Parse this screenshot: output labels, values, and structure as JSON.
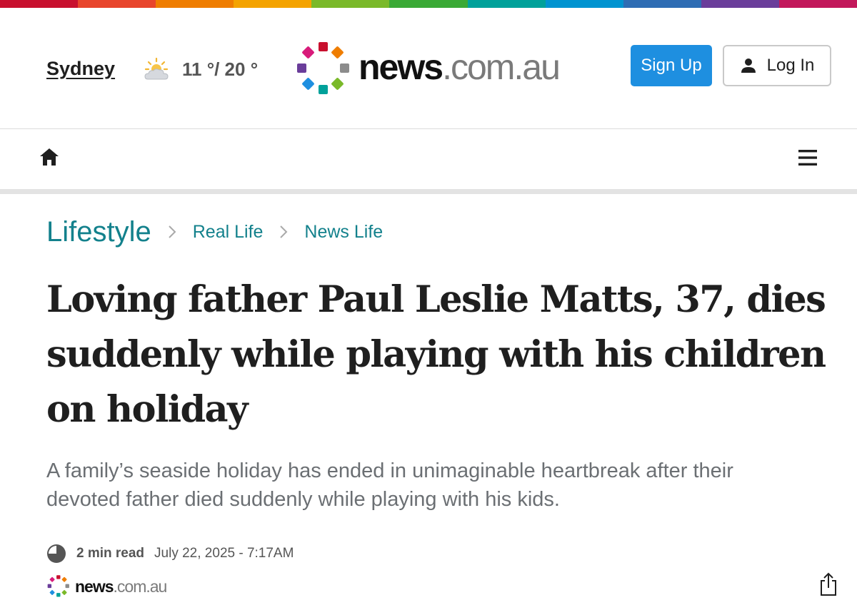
{
  "colors": {
    "stripe": [
      "#c8102e",
      "#e8452c",
      "#ef7d00",
      "#f4a300",
      "#7ab929",
      "#3aa935",
      "#00a19a",
      "#0093d0",
      "#2e6db4",
      "#6a3d9a",
      "#c2185b"
    ],
    "accent_link": "#13818c",
    "signup_bg": "#1e8fe0"
  },
  "header": {
    "city": "Sydney",
    "weather_icon": "partly-cloudy-icon",
    "temperature": "11 °/ 20 °",
    "logo": {
      "brand": "news",
      "suffix": ".com.au"
    },
    "signup_label": "Sign Up",
    "login_label": "Log In"
  },
  "nav": {
    "home_icon": "home-icon",
    "menu_icon": "hamburger-menu-icon"
  },
  "breadcrumb": [
    "Lifestyle",
    "Real Life",
    "News Life"
  ],
  "article": {
    "headline": "Loving father Paul Leslie Matts, 37, dies suddenly while playing with his children on holiday",
    "standfirst": "A family’s seaside holiday has ended in unimaginable heartbreak after their devoted father died suddenly while playing with his kids.",
    "read_time": "2 min read",
    "date": "July 22, 2025 - 7:17AM",
    "source": {
      "brand": "news",
      "suffix": ".com.au"
    }
  }
}
